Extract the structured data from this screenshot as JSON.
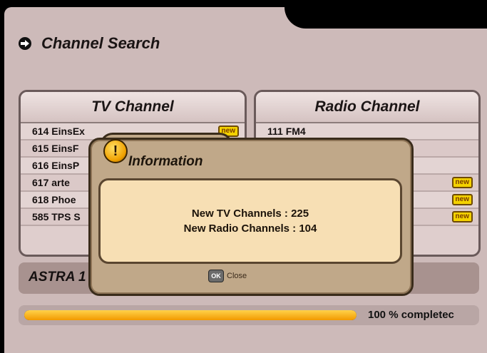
{
  "header": {
    "title": "Channel Search",
    "icon": "arrow-right-icon"
  },
  "tv_panel": {
    "heading": "TV Channel",
    "rows": [
      {
        "text": "614 EinsEx",
        "badge": "new"
      },
      {
        "text": "615 EinsF",
        "badge": ""
      },
      {
        "text": "616 EinsP",
        "badge": ""
      },
      {
        "text": "617 arte",
        "badge": ""
      },
      {
        "text": "618 Phoe",
        "badge": ""
      },
      {
        "text": "585 TPS S",
        "badge": ""
      }
    ]
  },
  "radio_panel": {
    "heading": "Radio Channel",
    "rows": [
      {
        "text": "111 FM4",
        "badge": ""
      },
      {
        "text": "",
        "badge": ""
      },
      {
        "text": "",
        "badge": ""
      },
      {
        "text": "",
        "badge": "new"
      },
      {
        "text": "",
        "badge": "new"
      },
      {
        "text": "",
        "badge": "new"
      }
    ]
  },
  "satellite": {
    "name": "ASTRA 1"
  },
  "progress": {
    "percent": 100,
    "label": "100 % completec"
  },
  "dialog": {
    "title": "Information",
    "icon": "exclamation-icon",
    "line1": "New TV Channels : 225",
    "line2": "New Radio Channels : 104",
    "close_label": "Close",
    "ok_key": "OK"
  },
  "colors": {
    "background": "#cdbab9",
    "badge": "#f4d200",
    "progress": "#f29a00",
    "dialog": "#c0a889",
    "dialog_body": "#f7dfb4"
  }
}
